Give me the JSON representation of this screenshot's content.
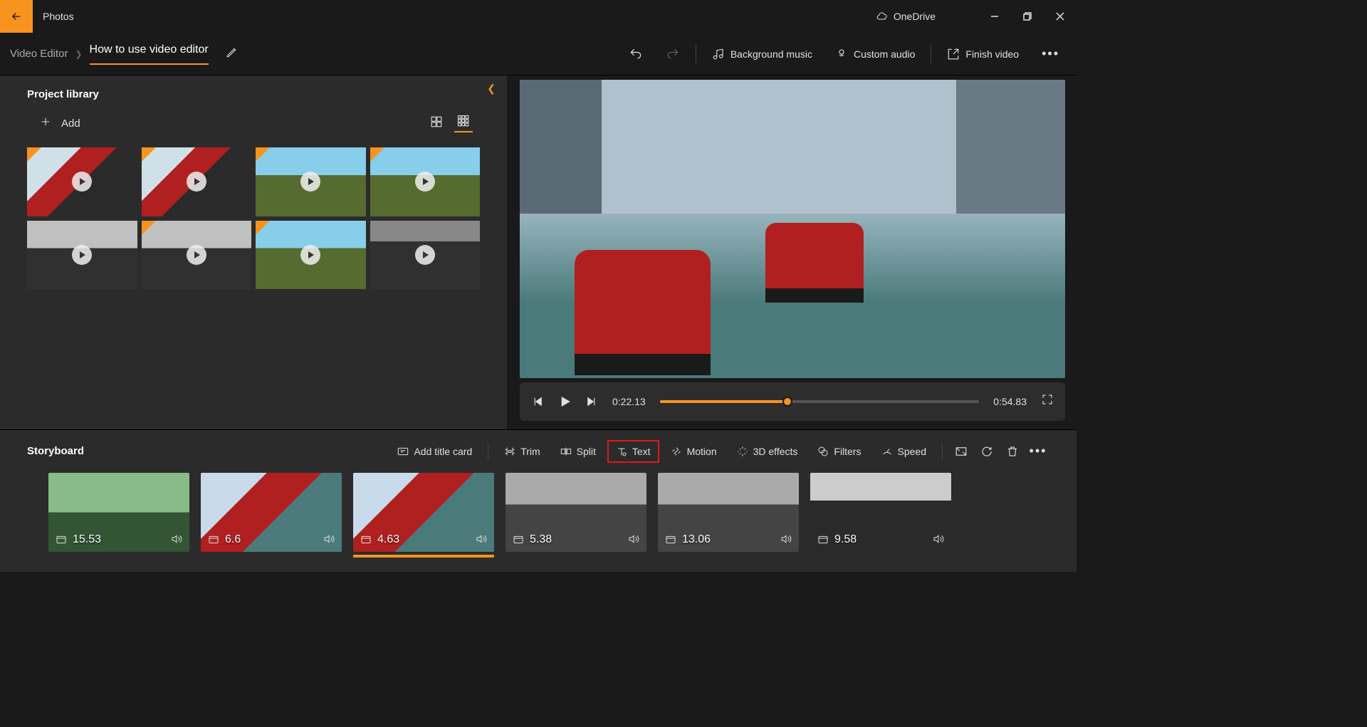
{
  "app": {
    "title": "Photos"
  },
  "titlebar": {
    "onedrive": "OneDrive"
  },
  "breadcrumb": {
    "editor": "Video Editor",
    "project_title": "How to use video editor"
  },
  "header": {
    "bg_music": "Background music",
    "custom_audio": "Custom audio",
    "finish": "Finish video"
  },
  "library": {
    "title": "Project library",
    "add": "Add"
  },
  "player": {
    "current_time": "0:22.13",
    "total_time": "0:54.83",
    "progress_pct": 40
  },
  "storyboard": {
    "title": "Storyboard",
    "tools": {
      "title_card": "Add title card",
      "trim": "Trim",
      "split": "Split",
      "text": "Text",
      "motion": "Motion",
      "effects_3d": "3D effects",
      "filters": "Filters",
      "speed": "Speed"
    },
    "clips": [
      {
        "dur": "15.53"
      },
      {
        "dur": "6.6"
      },
      {
        "dur": "4.63"
      },
      {
        "dur": "5.38"
      },
      {
        "dur": "13.06"
      },
      {
        "dur": "9.58"
      }
    ]
  }
}
